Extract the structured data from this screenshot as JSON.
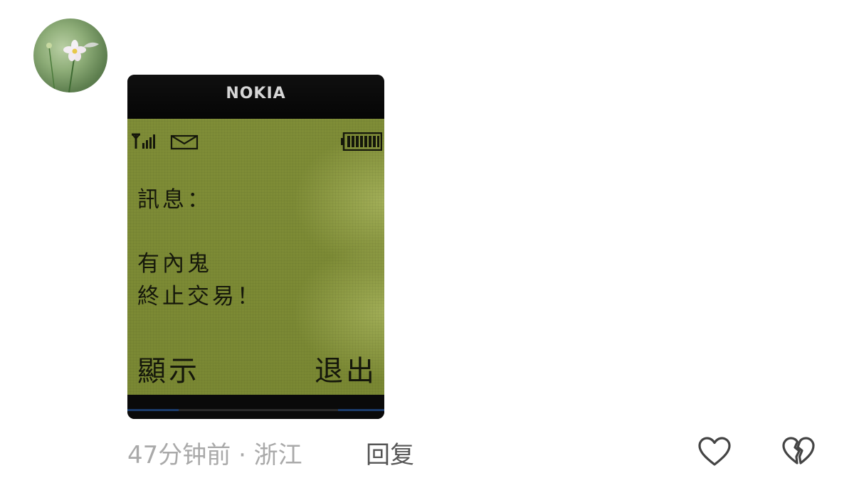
{
  "comment": {
    "avatar_icon": "flower-avatar",
    "image": {
      "brand": "NOKIA",
      "status_icons": [
        "signal-icon",
        "envelope-icon",
        "battery-icon"
      ],
      "message_label": "訊息：",
      "message_line1": "有內鬼",
      "message_line2": "終止交易！",
      "softkey_left": "顯示",
      "softkey_right": "退出",
      "screen_color": "#7d8b35"
    },
    "meta": "47分钟前 · 浙江",
    "reply_label": "回复",
    "like_icon": "heart-outline-icon",
    "dislike_icon": "broken-heart-icon"
  }
}
